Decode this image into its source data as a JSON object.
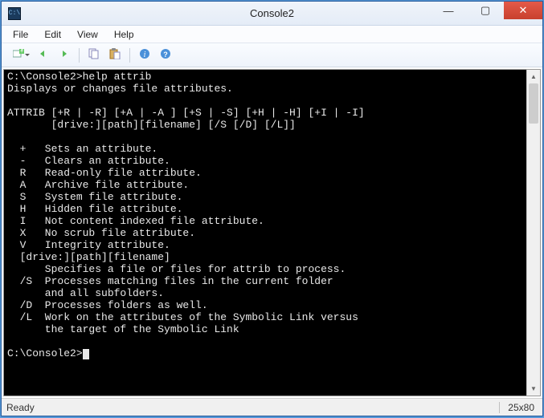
{
  "window": {
    "title": "Console2",
    "controls": {
      "min": "—",
      "max": "▢",
      "close": "✕"
    }
  },
  "menubar": {
    "items": [
      {
        "label": "File"
      },
      {
        "label": "Edit"
      },
      {
        "label": "View"
      },
      {
        "label": "Help"
      }
    ]
  },
  "toolbar": {
    "icons": {
      "new_tab": "new-tab-icon",
      "prev": "prev-tab-icon",
      "next": "next-tab-icon",
      "copy": "copy-icon",
      "paste": "paste-icon",
      "info": "info-icon",
      "info2": "info2-icon"
    }
  },
  "console": {
    "prompt1": "C:\\Console2>help attrib",
    "lines": [
      "Displays or changes file attributes.",
      "",
      "ATTRIB [+R | -R] [+A | -A ] [+S | -S] [+H | -H] [+I | -I]",
      "       [drive:][path][filename] [/S [/D] [/L]]",
      "",
      "  +   Sets an attribute.",
      "  -   Clears an attribute.",
      "  R   Read-only file attribute.",
      "  A   Archive file attribute.",
      "  S   System file attribute.",
      "  H   Hidden file attribute.",
      "  I   Not content indexed file attribute.",
      "  X   No scrub file attribute.",
      "  V   Integrity attribute.",
      "  [drive:][path][filename]",
      "      Specifies a file or files for attrib to process.",
      "  /S  Processes matching files in the current folder",
      "      and all subfolders.",
      "  /D  Processes folders as well.",
      "  /L  Work on the attributes of the Symbolic Link versus",
      "      the target of the Symbolic Link",
      ""
    ],
    "prompt2": "C:\\Console2>"
  },
  "statusbar": {
    "left": "Ready",
    "right": "25x80"
  }
}
